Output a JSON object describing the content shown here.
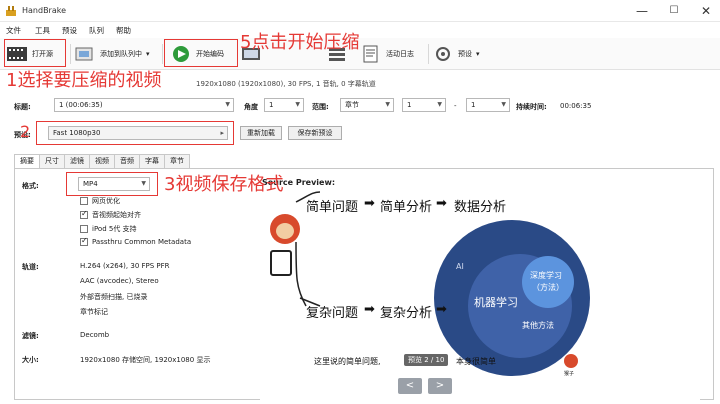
{
  "window": {
    "title": "HandBrake",
    "minimize": "—",
    "maximize": "☐",
    "close": "✕"
  },
  "menu": [
    "文件",
    "工具",
    "预设",
    "队列",
    "帮助"
  ],
  "toolbar": {
    "open_source": "打开源",
    "add_to_queue": "添加到队列中",
    "start_encode": "开始编码",
    "activity_log": "活动日志",
    "presets": "预设",
    "dropdown": "▾"
  },
  "source_info": "1920x1080 (1920x1080), 30 FPS, 1 音轨, 0 字幕轨道",
  "title_row": {
    "title_label": "标题:",
    "title_value": "1 (00:06:35)",
    "angle_label": "角度",
    "angle_value": "1",
    "range_label": "范围:",
    "range_value": "章节",
    "range_start": "1",
    "range_dash": "-",
    "range_end": "1",
    "duration_label": "持续时间:",
    "duration_value": "00:06:35"
  },
  "preset_row": {
    "label": "预设:",
    "value": "Fast 1080p30",
    "reload": "重新加载",
    "save_new": "保存新预设"
  },
  "tabs": [
    "摘要",
    "尺寸",
    "滤镜",
    "视频",
    "音频",
    "字幕",
    "章节"
  ],
  "summary": {
    "format_label": "格式:",
    "format_value": "MP4",
    "options": [
      {
        "label": "网页优化",
        "checked": false
      },
      {
        "label": "音视频起始对齐",
        "checked": true
      },
      {
        "label": "iPod 5代 支持",
        "checked": false
      },
      {
        "label": "Passthru Common Metadata",
        "checked": true
      }
    ],
    "tracks_label": "轨道:",
    "tracks": [
      "H.264 (x264), 30 FPS PFR",
      "AAC (avcodec), Stereo",
      "外部音频扫描, 已烧录",
      "章节标记"
    ],
    "filters_label": "滤镜:",
    "filters_value": "Decomb",
    "size_label": "大小:",
    "size_value": "1920x1080 存储空间, 1920x1080 显示"
  },
  "preview": {
    "heading": "Source Preview:",
    "simple_problem": "简单问题",
    "simple_analysis": "简单分析",
    "data_analysis": "数据分析",
    "complex_problem": "复杂问题",
    "complex_analysis": "复杂分析",
    "ai": "AI",
    "ml": "机器学习",
    "dl_line1": "深度学习",
    "dl_line2": "（方法）",
    "other": "其他方法",
    "caption_left": "这里说的简单问题,",
    "caption_badge": "预览 2 / 10",
    "caption_right": "本身很简单",
    "mascot_label": "猴子",
    "prev": "<",
    "next": ">"
  },
  "annotations": {
    "a1": "1选择要压缩的视频",
    "a2": "2",
    "a3": "3视频保存格式",
    "a5": "5点击开始压缩"
  },
  "colors": {
    "annotation": "#e53935",
    "circle_outer": "#2a4a86",
    "circle_mid": "#3f62a8",
    "circle_inner": "#5c94de",
    "start_button": "#2e9b3a"
  }
}
